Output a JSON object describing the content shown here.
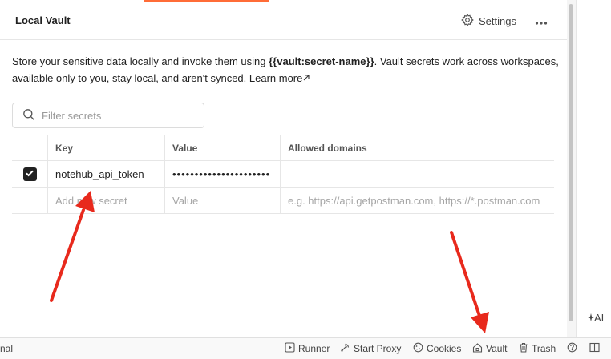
{
  "header": {
    "title": "Local Vault",
    "settings_label": "Settings",
    "settings_icon": "gear-icon",
    "more_icon": "ellipsis-icon"
  },
  "description": {
    "text_before": "Store your sensitive data locally and invoke them using ",
    "syntax": "{{vault:secret-name}}",
    "text_after": ". Vault secrets work across workspaces, available only to you, stay local, and aren't synced. ",
    "learn_more": "Learn more",
    "learn_more_icon": "external-link-icon"
  },
  "filter": {
    "placeholder": "Filter secrets",
    "value": "",
    "icon": "search-icon"
  },
  "table": {
    "columns": [
      "Key",
      "Value",
      "Allowed domains"
    ],
    "rows": [
      {
        "checked": true,
        "key": "notehub_api_token",
        "value": "••••••••••••••••••••••",
        "allowed_domains": ""
      }
    ],
    "new_row": {
      "key_placeholder": "Add new secret",
      "value_placeholder": "Value",
      "domains_placeholder": "e.g. https://api.getpostman.com, https://*.postman.com"
    }
  },
  "right_panel": {
    "ai_label": "AI",
    "ai_icon": "sparkle-icon"
  },
  "statusbar": {
    "left_text": "nal",
    "items": [
      {
        "label": "Runner",
        "icon": "runner-icon"
      },
      {
        "label": "Start Proxy",
        "icon": "proxy-icon"
      },
      {
        "label": "Cookies",
        "icon": "cookie-icon"
      },
      {
        "label": "Vault",
        "icon": "vault-icon"
      },
      {
        "label": "Trash",
        "icon": "trash-icon"
      }
    ],
    "help_icon": "help-icon",
    "layout_icon": "two-pane-layout-icon"
  },
  "colors": {
    "accent": "#ff6c37",
    "annotation_arrow": "#e8291c",
    "text": "#212121"
  }
}
